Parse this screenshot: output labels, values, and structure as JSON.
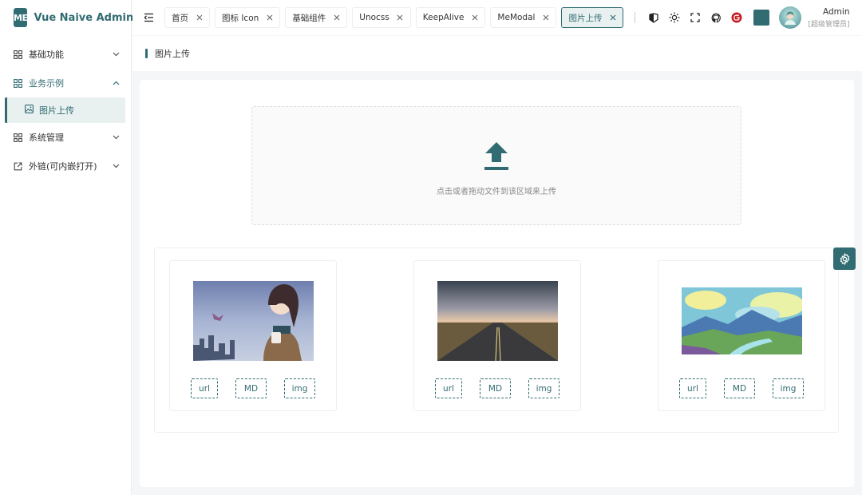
{
  "app": {
    "logo_mark": "ME",
    "title": "Vue Naive Admin"
  },
  "sidebar": {
    "items": [
      {
        "label": "基础功能",
        "icon": "grid-icon",
        "expanded": false
      },
      {
        "label": "业务示例",
        "icon": "grid-icon",
        "expanded": true,
        "children": [
          {
            "label": "图片上传",
            "icon": "image-icon",
            "active": true
          }
        ]
      },
      {
        "label": "系统管理",
        "icon": "grid-icon",
        "expanded": false
      },
      {
        "label": "外链(可内嵌打开)",
        "icon": "external-link-icon",
        "expanded": false
      }
    ]
  },
  "header": {
    "tabs": [
      {
        "label": "首页"
      },
      {
        "label": "图标 Icon"
      },
      {
        "label": "基础组件"
      },
      {
        "label": "Unocss"
      },
      {
        "label": "KeepAlive"
      },
      {
        "label": "MeModal"
      },
      {
        "label": "图片上传",
        "active": true
      }
    ],
    "icons": [
      "docs-icon",
      "sun-icon",
      "fullscreen-icon",
      "github-icon",
      "gitee-icon"
    ],
    "theme_color": "#316c72",
    "user": {
      "name": "Admin",
      "role": "[超级管理员]"
    }
  },
  "breadcrumb": {
    "title": "图片上传"
  },
  "upload": {
    "icon": "upload-icon",
    "hint": "点击或者拖动文件到该区域来上传"
  },
  "gallery": {
    "cards": [
      {
        "image": "anime-girl-cityscape",
        "actions": [
          "url",
          "MD",
          "img"
        ]
      },
      {
        "image": "road-sunset",
        "actions": [
          "url",
          "MD",
          "img"
        ]
      },
      {
        "image": "landscape-painting",
        "actions": [
          "url",
          "MD",
          "img"
        ]
      }
    ]
  },
  "colors": {
    "accent": "#316c72",
    "accent_light": "#e8f0f0"
  }
}
